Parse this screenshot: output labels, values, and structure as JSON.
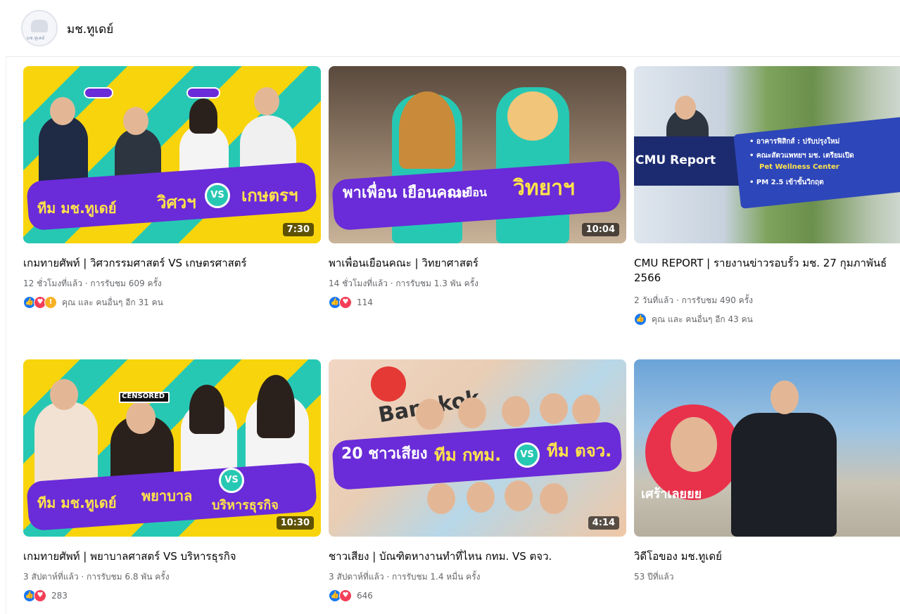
{
  "page": {
    "avatar_text": "มช.ทูเดย์",
    "name": "มช.ทูเดย์"
  },
  "videos": [
    {
      "title": "เกมทายศัพท์ | วิศวกรรมศาสตร์ VS เกษตรศาสตร์",
      "meta": "12 ชั่วโมงที่แล้ว · การรับชม 609 ครั้ง",
      "duration": "7:30",
      "reactions": [
        "like",
        "love",
        "wow"
      ],
      "reaction_text": "คุณ และ คนอื่นๆ อีก 31 คน",
      "thumb_text": {
        "left": "ทีม มช.ทูเดย์",
        "right_a": "วิศวฯ",
        "vs": "VS",
        "right_b": "เกษตรฯ"
      }
    },
    {
      "title": "พาเพื่อนเยือนคณะ | วิทยาศาสตร์",
      "meta": "14 ชั่วโมงที่แล้ว · การรับชม 1.3 พัน ครั้ง",
      "duration": "10:04",
      "reactions": [
        "like",
        "love"
      ],
      "reaction_text": "114",
      "thumb_text": {
        "left": "พาเพื่อน เยือนคณะ",
        "right_a": "มาเยือน",
        "right_b": "วิทยาฯ"
      }
    },
    {
      "title": "CMU REPORT | รายงานข่าวรอบรั้ว มช. 27 กุมภาพันธ์ 2566",
      "meta": "2 วันที่แล้ว · การรับชม 490 ครั้ง",
      "duration": "",
      "reactions": [
        "like"
      ],
      "reaction_text": "คุณ และ คนอื่นๆ อีก 43 คน",
      "thumb_text": {
        "left": "CMU Report",
        "right_a": "• อาคารฟิสิกส์ : ปรับปรุงใหม่",
        "right_b": "• คณะสัตวแพทยฯ มช. เตรียมเปิด",
        "right_c": "Pet Wellness Center",
        "right_d": "• PM 2.5 เข้าขั้นวิกฤต"
      }
    },
    {
      "title": "เกมทายศัพท์ | พยาบาลศาสตร์ VS บริหารธุรกิจ",
      "meta": "3 สัปดาห์ที่แล้ว · การรับชม 6.8 พัน ครั้ง",
      "duration": "10:30",
      "reactions": [
        "like",
        "love"
      ],
      "reaction_text": "283",
      "thumb_text": {
        "left": "ทีม มช.ทูเดย์",
        "right_a": "พยาบาล",
        "vs": "VS",
        "right_b": "บริหารธุรกิจ",
        "badge": "CENSORED"
      }
    },
    {
      "title": "ชาวเสียง | บัณฑิตหางานทำที่ไหน กทม. VS ตจว.",
      "meta": "3 สัปดาห์ที่แล้ว · การรับชม 1.4 หมื่น ครั้ง",
      "duration": "4:14",
      "reactions": [
        "like",
        "love"
      ],
      "reaction_text": "646",
      "thumb_text": {
        "left": "20 ชาวเสียง",
        "right_a": "ทีม กทม.",
        "vs": "VS",
        "right_b": "ทีม ตจว.",
        "map": "Bangkok"
      }
    },
    {
      "title": "วิดีโอของ มช.ทูเดย์",
      "meta": "53 ปีที่แล้ว",
      "duration": "",
      "reactions": [],
      "reaction_text": "",
      "thumb_text": {
        "left": "เศร้าเลยยย"
      }
    }
  ]
}
